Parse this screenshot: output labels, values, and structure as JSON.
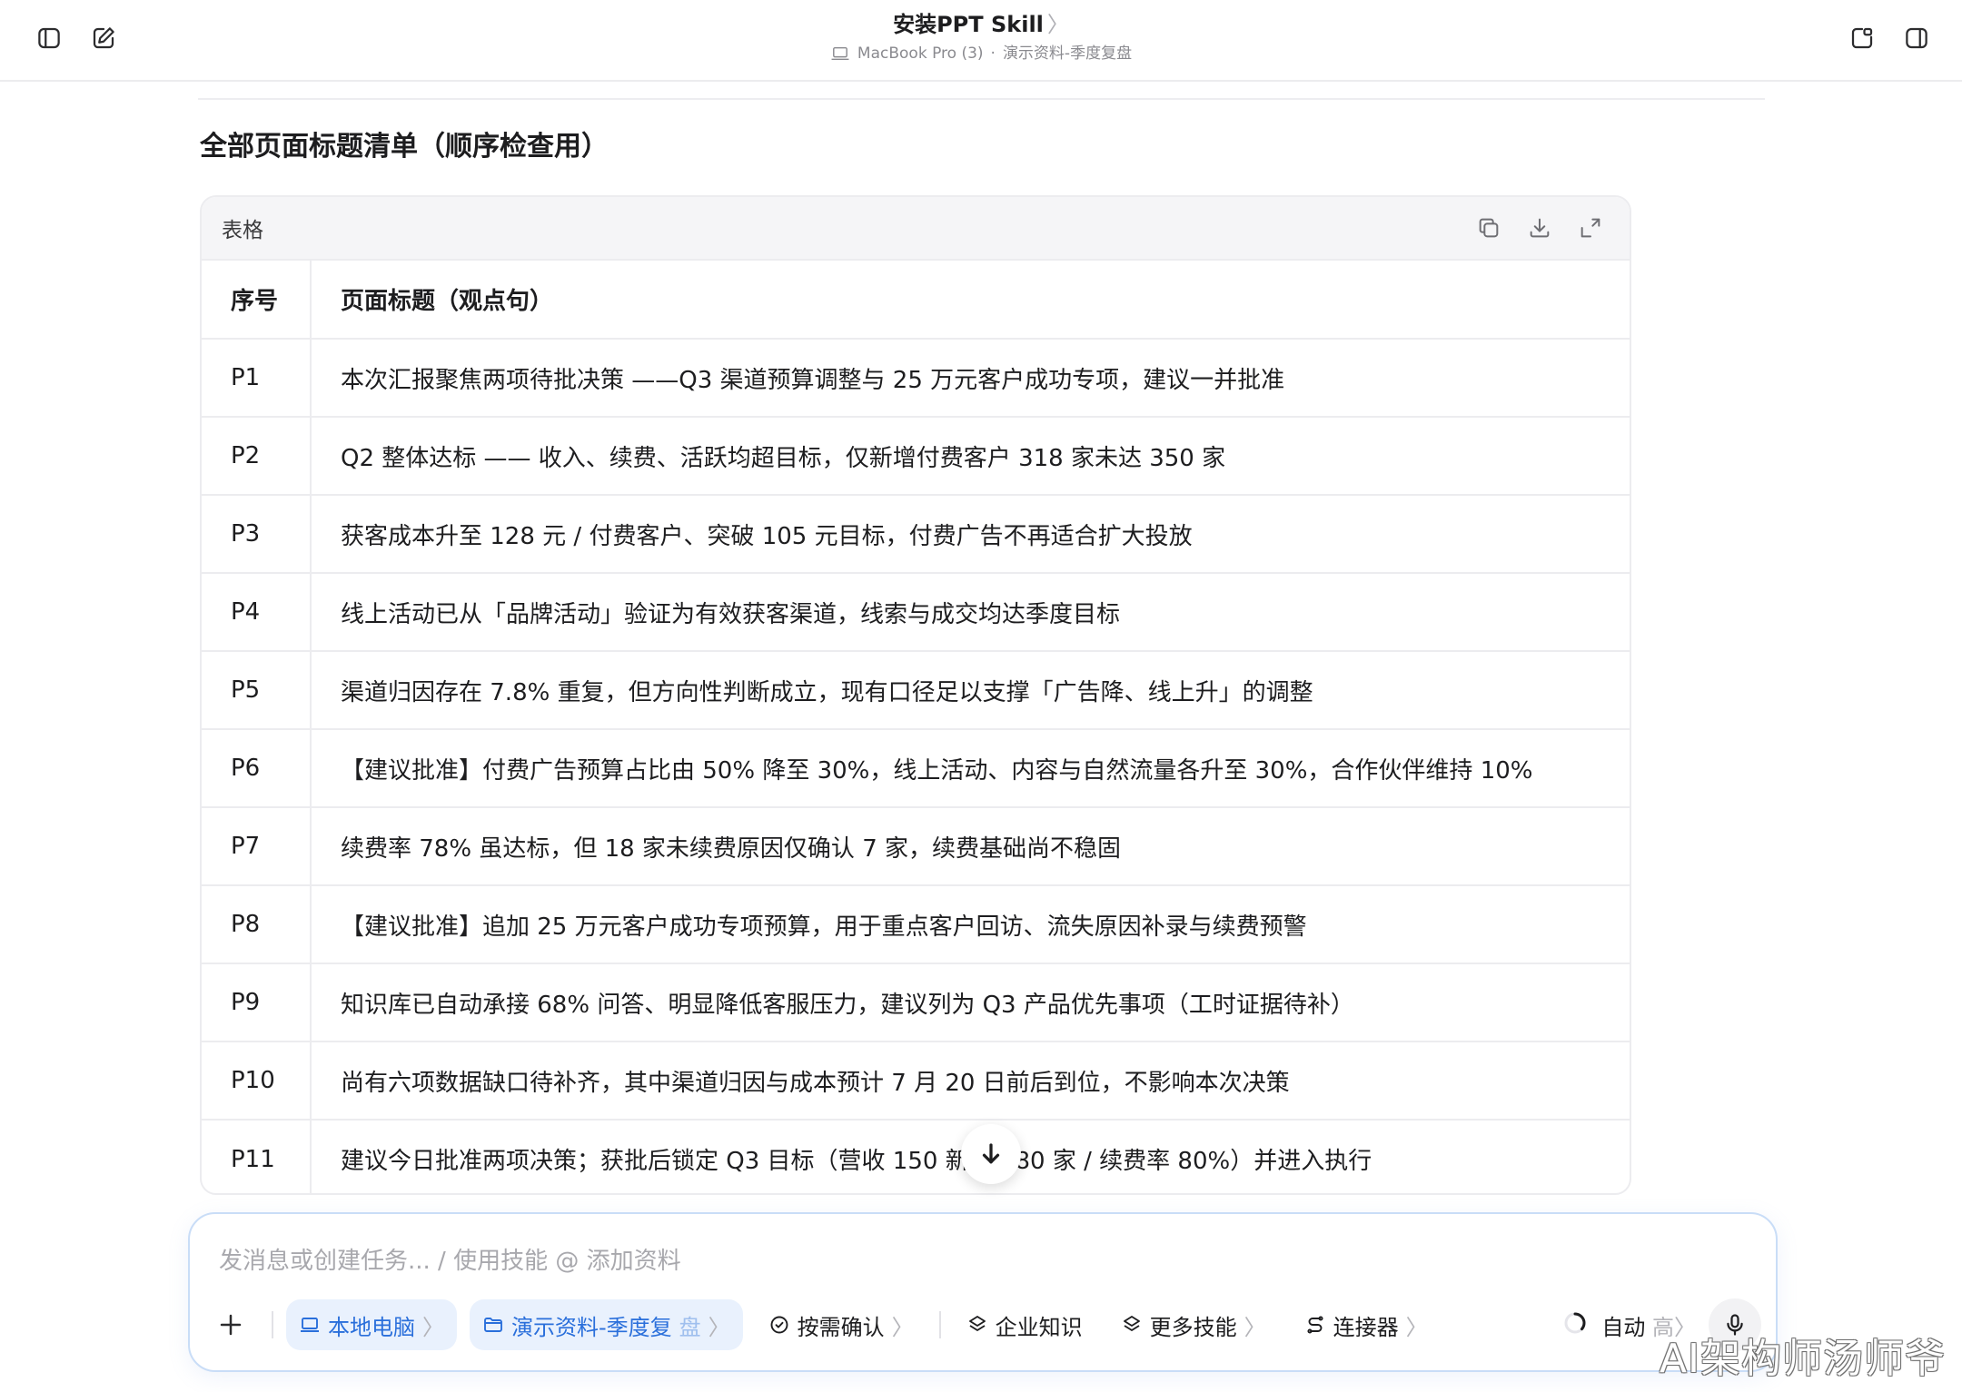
{
  "header": {
    "title": "安装PPT Skill",
    "title_chevron": "〉",
    "device": "MacBook Pro (3)",
    "separator": "·",
    "folder": "演示资料-季度复盘",
    "icons": {
      "left": [
        "sidebar-toggle-icon",
        "new-chat-icon"
      ],
      "right": [
        "preview-window-icon",
        "right-panel-icon"
      ]
    }
  },
  "section": {
    "title": "全部页面标题清单（顺序检查用）"
  },
  "table": {
    "toolbar_label": "表格",
    "toolbar_icons": [
      "copy-icon",
      "download-icon",
      "expand-icon"
    ],
    "headers": [
      "序号",
      "页面标题（观点句）"
    ],
    "rows": [
      [
        "P1",
        "本次汇报聚焦两项待批决策 ——Q3 渠道预算调整与 25 万元客户成功专项，建议一并批准"
      ],
      [
        "P2",
        "Q2 整体达标 —— 收入、续费、活跃均超目标，仅新增付费客户 318 家未达 350 家"
      ],
      [
        "P3",
        "获客成本升至 128 元 / 付费客户、突破 105 元目标，付费广告不再适合扩大投放"
      ],
      [
        "P4",
        "线上活动已从「品牌活动」验证为有效获客渠道，线索与成交均达季度目标"
      ],
      [
        "P5",
        "渠道归因存在 7.8% 重复，但方向性判断成立，现有口径足以支撑「广告降、线上升」的调整"
      ],
      [
        "P6",
        "【建议批准】付费广告预算占比由 50% 降至 30%，线上活动、内容与自然流量各升至 30%，合作伙伴维持 10%"
      ],
      [
        "P7",
        "续费率 78% 虽达标，但 18 家未续费原因仅确认 7 家，续费基础尚不稳固"
      ],
      [
        "P8",
        "【建议批准】追加 25 万元客户成功专项预算，用于重点客户回访、流失原因补录与续费预警"
      ],
      [
        "P9",
        "知识库已自动承接 68% 问答、明显降低客服压力，建议列为 Q3 产品优先事项（工时证据待补）"
      ],
      [
        "P10",
        "尚有六项数据缺口待补齐，其中渠道归因与成本预计 7 月 20 日前后到位，不影响本次决策"
      ],
      [
        "P11",
        "建议今日批准两项决策；获批后锁定 Q3 目标（营收 150     新增 380 家 / 续费率 80%）并进入执行"
      ]
    ]
  },
  "composer": {
    "placeholder": "发消息或创建任务... / 使用技能 @ 添加资料",
    "chips": {
      "local": "本地电脑",
      "folder": "演示资料-季度复",
      "folder_fade": "盘",
      "confirm": "按需确认",
      "knowledge": "企业知识",
      "skills": "更多技能",
      "connectors": "连接器"
    },
    "chevron": "〉",
    "mode_label": "自动",
    "mode_level": "高〉"
  },
  "watermark": "AI架构师汤师爷"
}
